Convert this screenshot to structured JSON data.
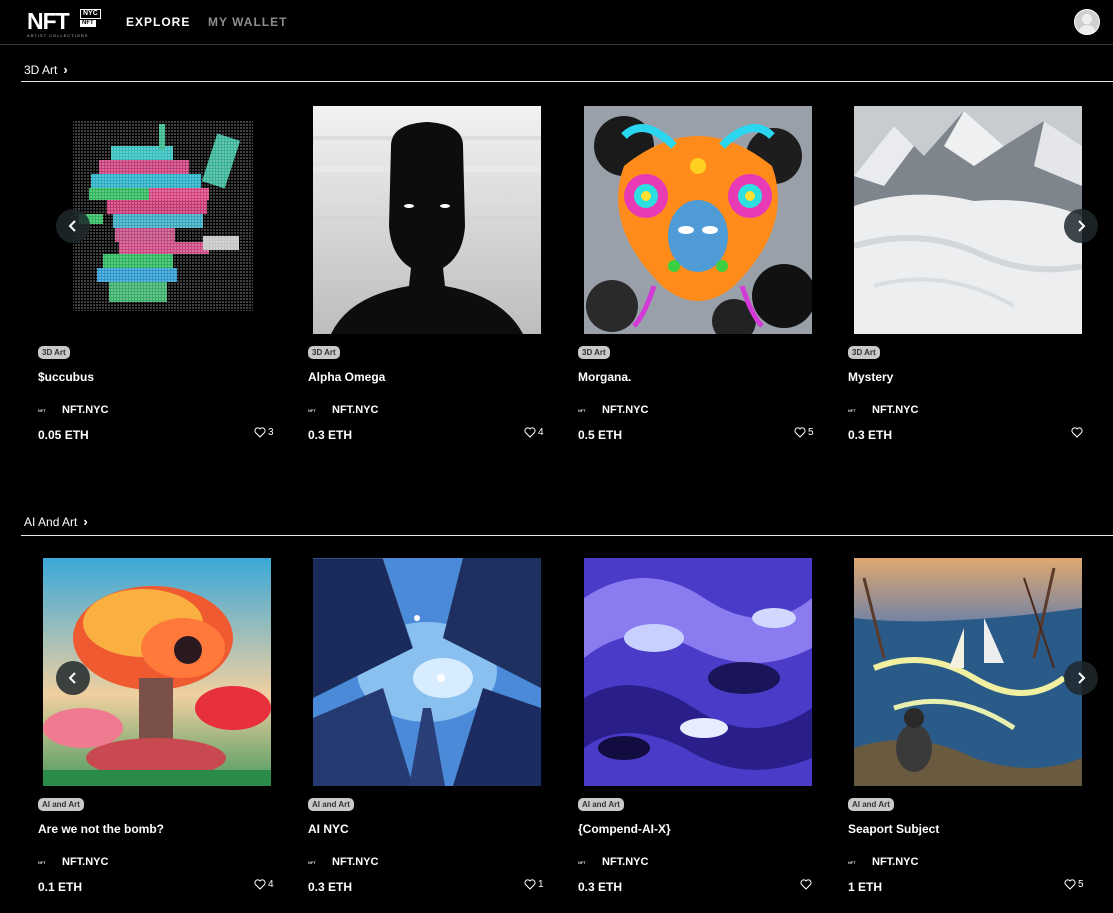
{
  "logo": {
    "big": "NFT",
    "nyc": "NYC",
    "tag": "NFT",
    "sub": "ARTIST COLLECTIONS"
  },
  "nav": {
    "explore": "EXPLORE",
    "wallet": "MY WALLET"
  },
  "sections": [
    {
      "title": "3D Art",
      "cards": [
        {
          "badge": "3D Art",
          "title": "$uccubus",
          "creator": "NFT.NYC",
          "price": "0.05 ETH",
          "likes": "3"
        },
        {
          "badge": "3D Art",
          "title": "Alpha Omega",
          "creator": "NFT.NYC",
          "price": "0.3 ETH",
          "likes": "4"
        },
        {
          "badge": "3D Art",
          "title": "Morgana.",
          "creator": "NFT.NYC",
          "price": "0.5 ETH",
          "likes": "5"
        },
        {
          "badge": "3D Art",
          "title": "Mystery",
          "creator": "NFT.NYC",
          "price": "0.3 ETH",
          "likes": ""
        }
      ]
    },
    {
      "title": "AI And Art",
      "cards": [
        {
          "badge": "AI and Art",
          "title": "Are we not the bomb?",
          "creator": "NFT.NYC",
          "price": "0.1 ETH",
          "likes": "4"
        },
        {
          "badge": "AI and Art",
          "title": "AI NYC",
          "creator": "NFT.NYC",
          "price": "0.3 ETH",
          "likes": "1"
        },
        {
          "badge": "AI and Art",
          "title": "{Compend-AI-X}",
          "creator": "NFT.NYC",
          "price": "0.3 ETH",
          "likes": ""
        },
        {
          "badge": "AI and Art",
          "title": "Seaport Subject",
          "creator": "NFT.NYC",
          "price": "1 ETH",
          "likes": "5"
        }
      ]
    }
  ],
  "creator_logo_text": "NFT"
}
